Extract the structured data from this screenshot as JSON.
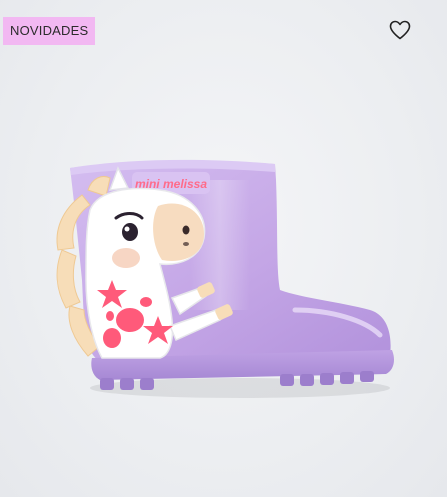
{
  "badge": {
    "label": "NOVIDADES",
    "color": "#f2b8f2"
  },
  "favorite": {
    "icon": "heart-outline-icon"
  },
  "product": {
    "image": "lilac-rain-boot-unicorn",
    "brand_logo": "mini melissa",
    "colors": {
      "boot": "#c6a9e6",
      "sole": "#b596dd",
      "accent": "#ff5a7a"
    }
  }
}
